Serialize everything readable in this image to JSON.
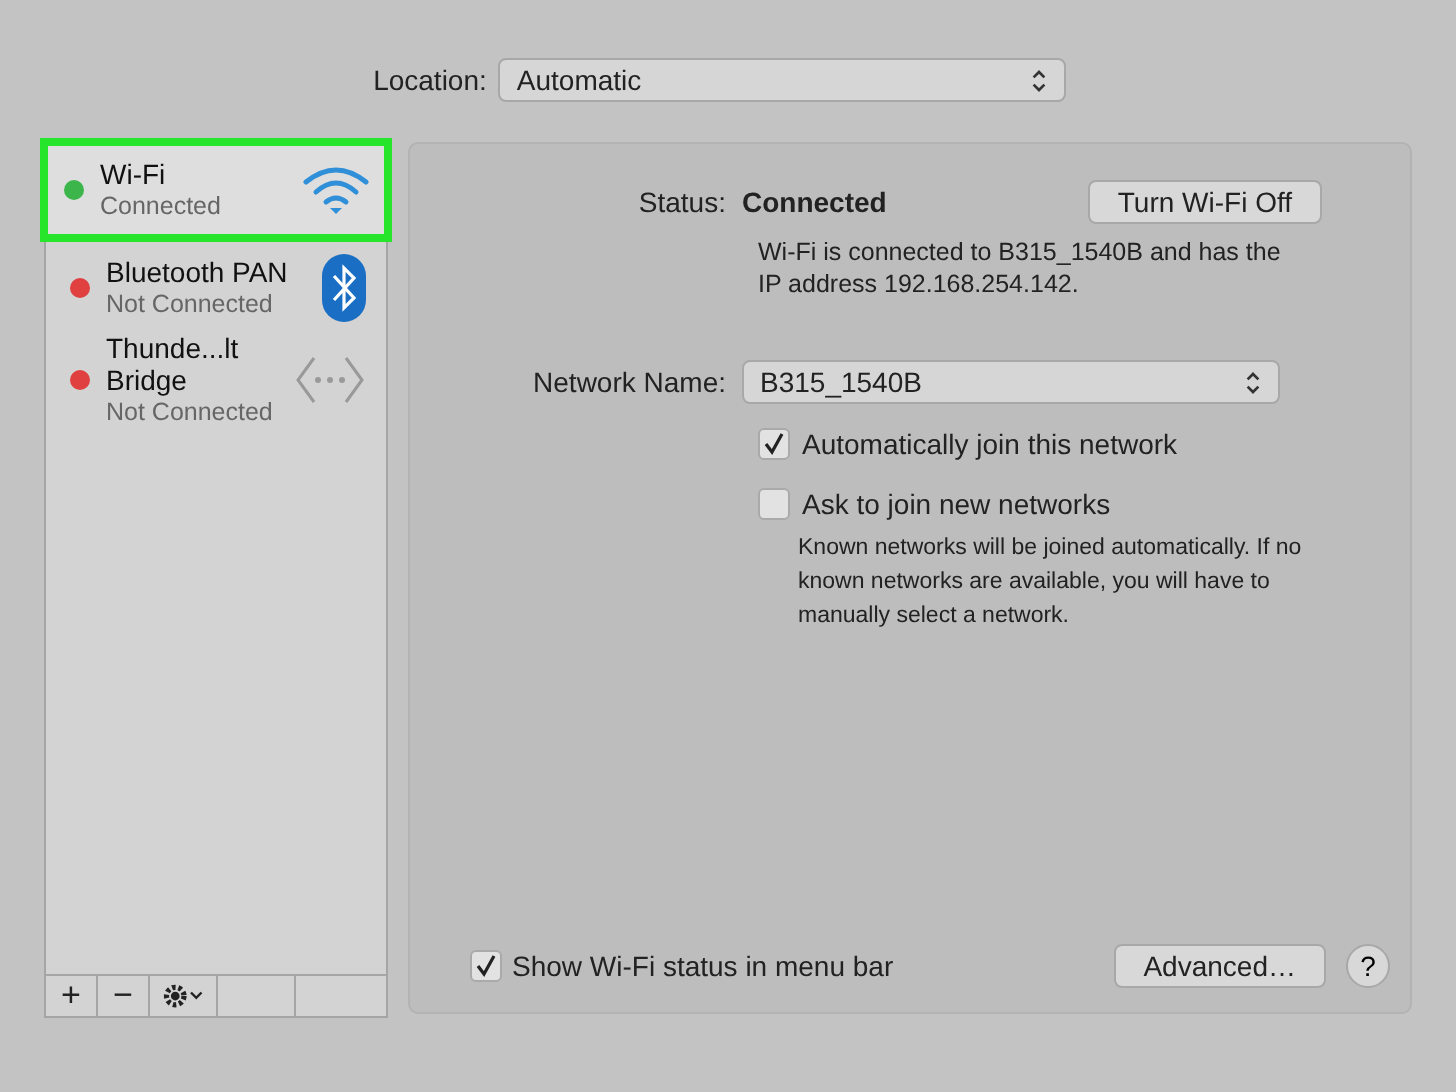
{
  "location": {
    "label": "Location:",
    "value": "Automatic"
  },
  "services": [
    {
      "name": "Wi-Fi",
      "status": "Connected",
      "color": "#3cb54a",
      "kind": "wifi",
      "selected": true
    },
    {
      "name": "Bluetooth PAN",
      "status": "Not Connected",
      "color": "#e04040",
      "kind": "bluetooth",
      "selected": false
    },
    {
      "name": "Thunde...lt Bridge",
      "status": "Not Connected",
      "color": "#e04040",
      "kind": "bridge",
      "selected": false
    }
  ],
  "sidebar_buttons": [
    "+",
    "−"
  ],
  "status": {
    "label": "Status:",
    "value": "Connected",
    "button": "Turn Wi-Fi Off",
    "description": "Wi-Fi is connected to B315_1540B and has the IP address 192.168.254.142."
  },
  "network_name": {
    "label": "Network Name:",
    "value": "B315_1540B"
  },
  "options": [
    {
      "label": "Automatically join this network",
      "checked": true
    },
    {
      "label": "Ask to join new networks",
      "checked": false
    }
  ],
  "note": "Known networks will be joined automatically. If no known networks are available, you will have to manually select a network.",
  "menu_bar_option": {
    "label": "Show Wi-Fi status in menu bar",
    "checked": true
  },
  "advanced_button": "Advanced…",
  "help_button": "?"
}
